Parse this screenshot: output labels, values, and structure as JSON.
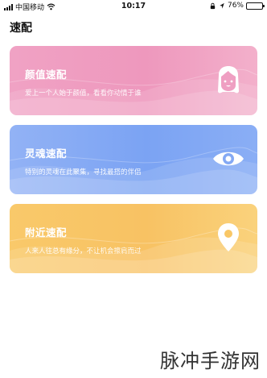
{
  "status_bar": {
    "carrier": "中国移动",
    "time": "10:17",
    "battery_text": "76%",
    "battery_level": 0.76
  },
  "page": {
    "title": "速配"
  },
  "cards": [
    {
      "title": "颜值速配",
      "desc": "爱上一个人始于颜值，看看你动情于谁",
      "icon": "girl-face-icon",
      "color": "#ef9fc2"
    },
    {
      "title": "灵魂速配",
      "desc": "特别的灵魂在此聚集，寻找最搭的伴侣",
      "icon": "eye-icon",
      "color": "#84a9f4"
    },
    {
      "title": "附近速配",
      "desc": "人来人往总有缘分，不让机会擦肩而过",
      "icon": "location-pin-icon",
      "color": "#f9c766"
    }
  ],
  "watermark": "脉冲手游网"
}
